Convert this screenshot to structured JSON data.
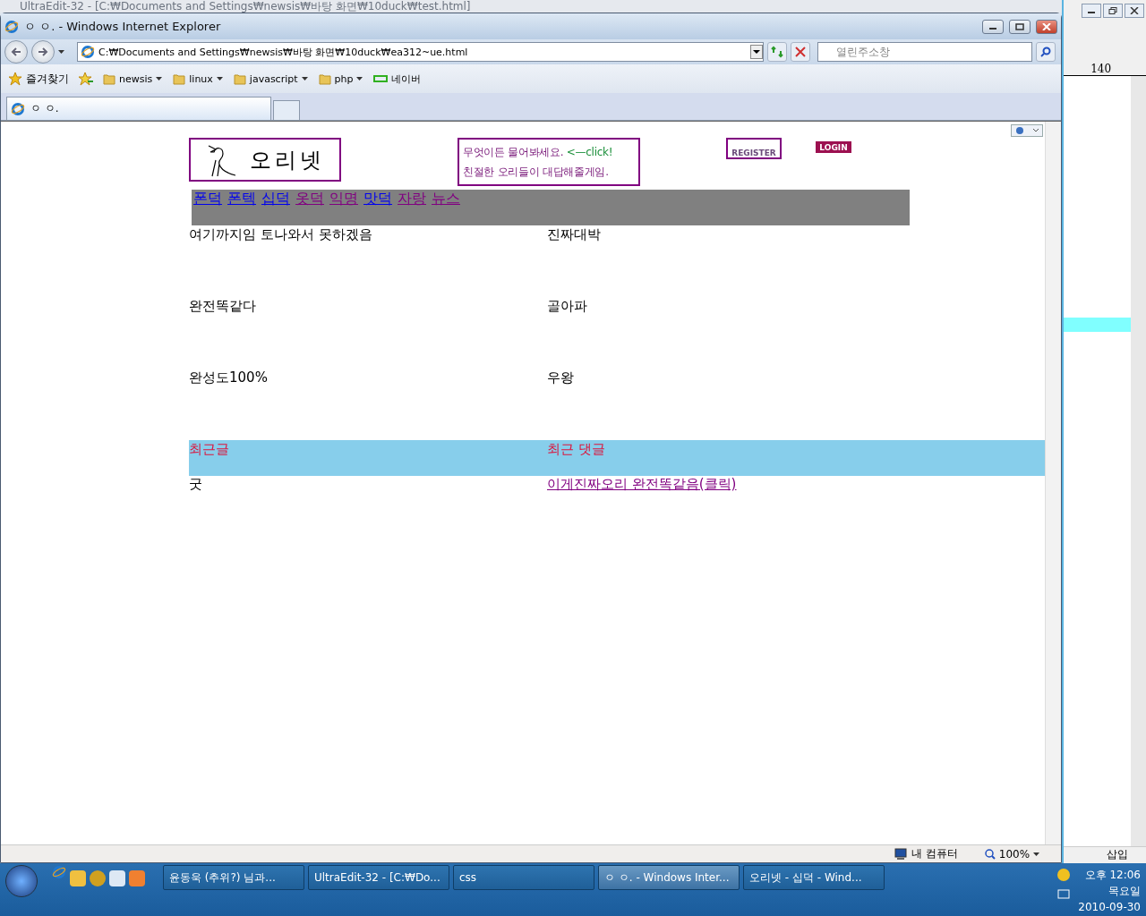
{
  "background_window": {
    "title": "UltraEdit-32 - [C:₩Documents and Settings₩newsis₩바탕 화면₩10duck₩test.html]",
    "ruler_label": "140",
    "status": "삽입"
  },
  "window": {
    "title": "ㅇ ㅇ. - Windows Internet Explorer"
  },
  "address_bar": {
    "value": "C:₩Documents and Settings₩newsis₩바탕 화면₩10duck₩ea312~ue.html"
  },
  "search": {
    "placeholder": "열린주소창"
  },
  "favorites": {
    "label": "즐겨찾기",
    "items": [
      {
        "label": "newsis",
        "kind": "folder"
      },
      {
        "label": "linux",
        "kind": "folder"
      },
      {
        "label": "javascript",
        "kind": "folder"
      },
      {
        "label": "php",
        "kind": "folder"
      },
      {
        "label": "네이버",
        "kind": "link"
      }
    ]
  },
  "tabs": [
    {
      "label": "ㅇ ㅇ.",
      "selected": true
    }
  ],
  "page": {
    "logo": {
      "text": "오리넷"
    },
    "banner": {
      "lines": [
        [
          {
            "text": "무엇이든 물어봐세요.",
            "kind": "plain"
          },
          {
            "text": "<—click!",
            "kind": "accent"
          }
        ],
        [
          {
            "text": "친절한 오리들이 대답해줄게임.",
            "kind": "plain"
          }
        ]
      ]
    },
    "register": "REGISTER",
    "login": "LOGIN",
    "nav": [
      {
        "label": "폰덕",
        "visited": false
      },
      {
        "label": "폰텍",
        "visited": false
      },
      {
        "label": "십덕",
        "visited": false
      },
      {
        "label": "옷덕",
        "visited": true
      },
      {
        "label": "익명",
        "visited": true
      },
      {
        "label": "맛덕",
        "visited": false
      },
      {
        "label": "자랑",
        "visited": true
      },
      {
        "label": "뉴스",
        "visited": true
      }
    ],
    "posts": [
      {
        "left": "여기까지임 토나와서 못하겠음",
        "right": "진짜대박"
      },
      {
        "left": "완전똑같다",
        "right": "골아파"
      },
      {
        "left": "완성도100%",
        "right": "우왕"
      }
    ],
    "recent": {
      "headers": [
        "최근글",
        "최근 댓글"
      ],
      "items": [
        {
          "text": "굿",
          "kind": "text"
        },
        {
          "text": "이게진짜오리 완전똑같음(클릭)",
          "kind": "link"
        }
      ]
    }
  },
  "status_bar": {
    "zone": "내 컴퓨터",
    "zoom": "100%"
  },
  "taskbar": {
    "buttons": [
      {
        "label": "윤동욱 (추위?) 님과...",
        "selected": false
      },
      {
        "label": "UltraEdit-32 - [C:₩Do...",
        "selected": false
      },
      {
        "label": "css",
        "selected": false
      },
      {
        "label": "ㅇ ㅇ. - Windows Inter...",
        "selected": true
      },
      {
        "label": "오리넷 - 십덕 - Wind...",
        "selected": false
      }
    ],
    "clock": {
      "time": "오후 12:06",
      "day": "목요일",
      "date": "2010-09-30"
    }
  }
}
